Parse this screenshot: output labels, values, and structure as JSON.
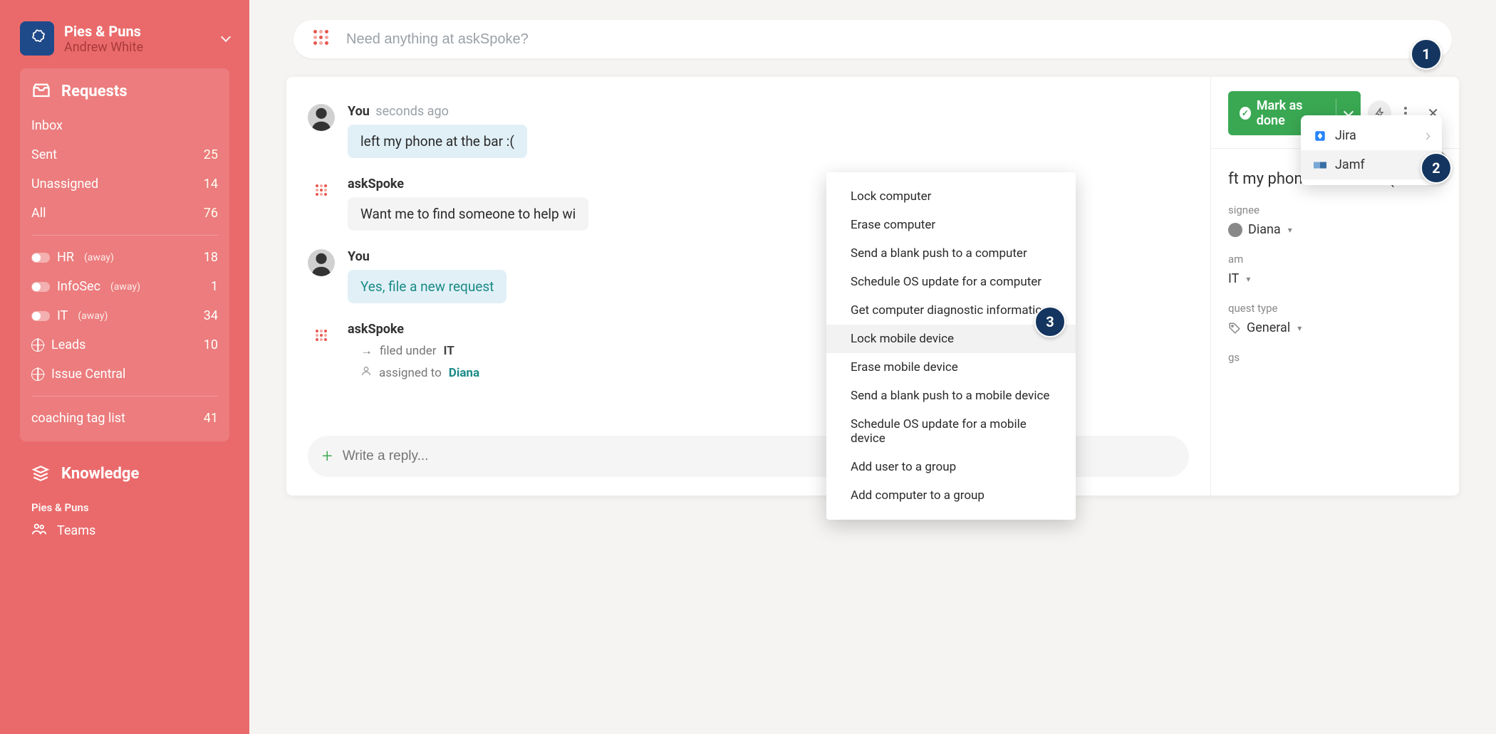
{
  "sidebar": {
    "org_name": "Pies & Puns",
    "user_name": "Andrew White",
    "section_requests_title": "Requests",
    "nav": [
      {
        "label": "Inbox",
        "count": ""
      },
      {
        "label": "Sent",
        "count": "25"
      },
      {
        "label": "Unassigned",
        "count": "14"
      },
      {
        "label": "All",
        "count": "76"
      }
    ],
    "teams": [
      {
        "label": "HR",
        "status": "(away)",
        "count": "18",
        "kind": "toggle"
      },
      {
        "label": "InfoSec",
        "status": "(away)",
        "count": "1",
        "kind": "toggle"
      },
      {
        "label": "IT",
        "status": "(away)",
        "count": "34",
        "kind": "toggle"
      },
      {
        "label": "Leads",
        "status": "",
        "count": "10",
        "kind": "globe"
      },
      {
        "label": "Issue Central",
        "status": "",
        "count": "",
        "kind": "globe"
      }
    ],
    "tag_list_label": "coaching tag list",
    "tag_list_count": "41",
    "knowledge_title": "Knowledge",
    "footer_org": "Pies & Puns",
    "footer_teams": "Teams"
  },
  "search": {
    "placeholder": "Need anything at askSpoke?"
  },
  "thread": {
    "messages": [
      {
        "author": "You",
        "time": "seconds ago",
        "text": "left my phone at the bar :(",
        "avatar": "person",
        "bubble": "teal"
      },
      {
        "author": "askSpoke",
        "time": "",
        "text": "Want me to find someone to help wi",
        "avatar": "bot",
        "bubble": "gray"
      },
      {
        "author": "You",
        "time": "",
        "text": "Yes, file a new request",
        "avatar": "person",
        "bubble": "teal",
        "bubbleTextClass": "teal-text"
      },
      {
        "author": "askSpoke",
        "time": "",
        "avatar": "bot"
      }
    ],
    "filed_under_label": "filed under",
    "filed_under_value": "IT",
    "assigned_to_label": "assigned to",
    "assigned_to_value": "Diana",
    "reply_placeholder": "Write a reply..."
  },
  "details": {
    "mark_done_label": "Mark as done",
    "title": "ft my phone at the bar :(",
    "assignee_label": "signee",
    "assignee_value": "Diana",
    "team_label": "am",
    "team_value": "IT",
    "type_label": "quest type",
    "type_value": "General",
    "tags_label": "gs"
  },
  "integration_menu": {
    "items": [
      {
        "label": "Jira",
        "has_sub": true
      },
      {
        "label": "Jamf",
        "has_sub": false
      }
    ]
  },
  "action_menu": {
    "items": [
      "Lock computer",
      "Erase computer",
      "Send a blank push to a computer",
      "Schedule OS update for a computer",
      "Get computer diagnostic information",
      "Lock mobile device",
      "Erase mobile device",
      "Send a blank push to a mobile device",
      "Schedule OS update for a mobile device",
      "Add user to a group",
      "Add computer to a group"
    ],
    "highlighted_index": 5
  },
  "badges": {
    "b1": "1",
    "b2": "2",
    "b3": "3"
  }
}
